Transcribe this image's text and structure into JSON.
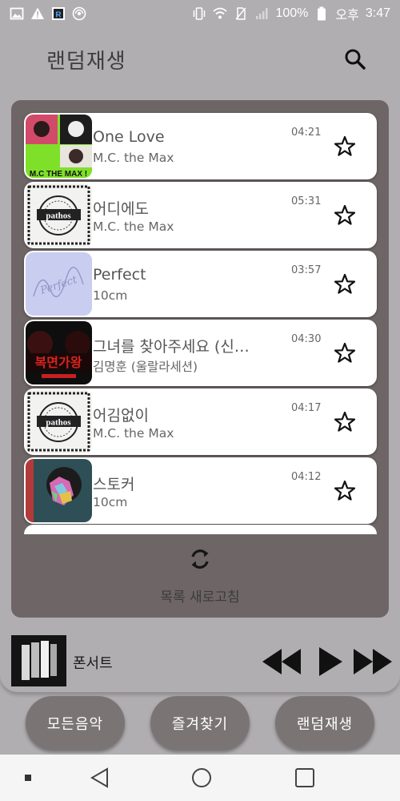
{
  "status_bar": {
    "battery": "100%",
    "ampm": "오후",
    "time": "3:47",
    "left_icons": [
      "image-icon",
      "warning-icon",
      "app-r-icon",
      "cast-icon"
    ],
    "right_icons": [
      "vibrate-icon",
      "wifi-icon",
      "no-sim-icon",
      "signal-icon",
      "battery-icon"
    ]
  },
  "header": {
    "title": "랜덤재생",
    "search_icon": "search-icon"
  },
  "songs": [
    {
      "title": "One Love",
      "artist": "M.C. the Max",
      "duration": "04:21",
      "art": "mc-the-max-album-art",
      "art_text": "M.C THE MAX !"
    },
    {
      "title": "어디에도",
      "artist": "M.C. the Max",
      "duration": "05:31",
      "art": "pathos-album-art",
      "art_text": "pathos"
    },
    {
      "title": "Perfect",
      "artist": "10cm",
      "duration": "03:57",
      "art": "perfect-album-art",
      "art_text": "Perfect"
    },
    {
      "title": "그녀를 찾아주세요 (신…",
      "artist": "김명훈 (울랄라세션)",
      "duration": "04:30",
      "art": "drama-ost-album-art",
      "art_text": "복면가왕"
    },
    {
      "title": "어김없이",
      "artist": "M.C. the Max",
      "duration": "04:17",
      "art": "pathos-album-art",
      "art_text": "pathos"
    },
    {
      "title": "스토커",
      "artist": "10cm",
      "duration": "04:12",
      "art": "stalker-album-art",
      "art_text": ""
    }
  ],
  "refresh": {
    "label": "목록 새로고침",
    "icon": "refresh-icon"
  },
  "player": {
    "title": "폰서트",
    "controls": [
      "rewind-icon",
      "play-icon",
      "fast-forward-icon"
    ]
  },
  "tabs": [
    {
      "label": "모든음악"
    },
    {
      "label": "즐겨찾기"
    },
    {
      "label": "랜덤재생"
    }
  ],
  "nav": [
    "recent-dot-icon",
    "back-icon",
    "home-icon",
    "overview-icon"
  ],
  "colors": {
    "background": "#b1aeb1",
    "panel": "#6e6566",
    "tab": "#7b7475"
  }
}
